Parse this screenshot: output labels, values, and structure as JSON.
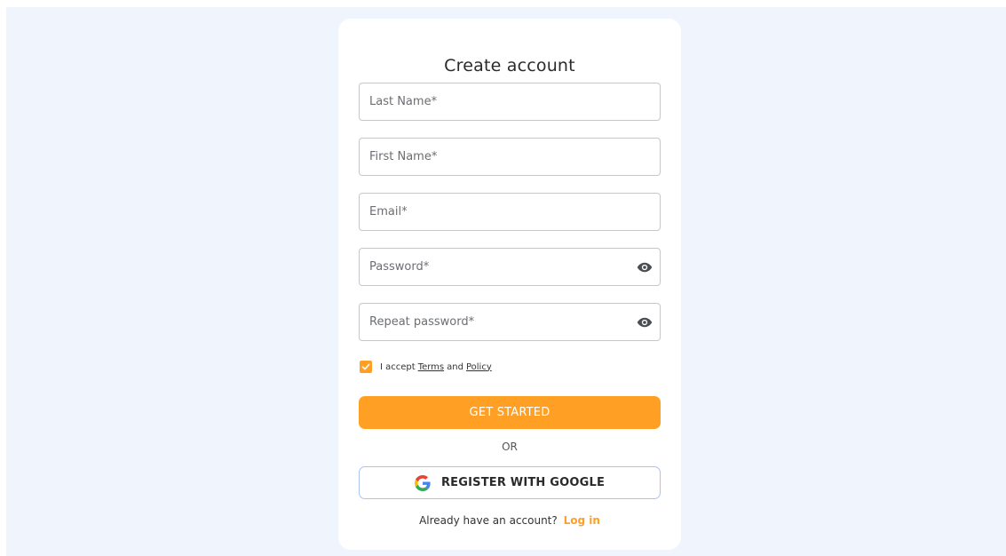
{
  "page": {
    "title": "Create account"
  },
  "form": {
    "fields": [
      {
        "label": "Last Name*"
      },
      {
        "label": "First Name*"
      },
      {
        "label": "Email*"
      },
      {
        "label": "Password*",
        "icon": "eye-icon"
      },
      {
        "label": "Repeat password*",
        "icon": "eye-icon"
      }
    ],
    "terms": {
      "checked": true,
      "prefix": "I accept",
      "terms_link": "Terms",
      "and": "and",
      "policy_link": "Policy"
    },
    "submit_label": "GET STARTED",
    "or_label": "OR",
    "google_label": "REGISTER WITH GOOGLE",
    "google_icon": "google-icon"
  },
  "footer": {
    "prompt": "Already have an account?",
    "login_link": "Log in"
  },
  "colors": {
    "accent": "#ffa024",
    "background": "#f0f4fd",
    "card": "#ffffff",
    "google_border": "#a9c6ef"
  }
}
